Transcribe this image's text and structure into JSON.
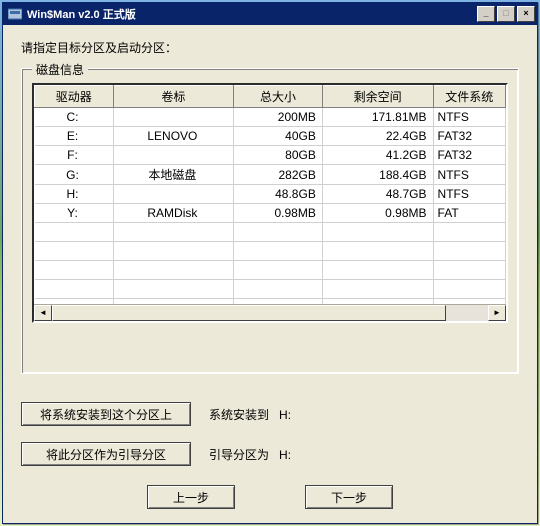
{
  "window": {
    "title": "Win$Man v2.0 正式版"
  },
  "instruction": "请指定目标分区及启动分区：",
  "group_label": "磁盘信息",
  "columns": {
    "drive": "驱动器",
    "label": "卷标",
    "total": "总大小",
    "free": "剩余空间",
    "fs": "文件系统"
  },
  "rows": [
    {
      "drive": "C:",
      "label": "",
      "total": "200MB",
      "free": "171.81MB",
      "fs": "NTFS"
    },
    {
      "drive": "E:",
      "label": "LENOVO",
      "total": "40GB",
      "free": "22.4GB",
      "fs": "FAT32"
    },
    {
      "drive": "F:",
      "label": "",
      "total": "80GB",
      "free": "41.2GB",
      "fs": "FAT32"
    },
    {
      "drive": "G:",
      "label": "本地磁盘",
      "total": "282GB",
      "free": "188.4GB",
      "fs": "NTFS"
    },
    {
      "drive": "H:",
      "label": "",
      "total": "48.8GB",
      "free": "48.7GB",
      "fs": "NTFS"
    },
    {
      "drive": "Y:",
      "label": "RAMDisk",
      "total": "0.98MB",
      "free": "0.98MB",
      "fs": "FAT"
    }
  ],
  "buttons": {
    "install_to": "将系统安装到这个分区上",
    "set_boot": "将此分区作为引导分区",
    "prev": "上一步",
    "next": "下一步"
  },
  "status": {
    "install_prefix": "系统安装到",
    "install_drive": "H:",
    "boot_prefix": "引导分区为",
    "boot_drive": "H:"
  }
}
